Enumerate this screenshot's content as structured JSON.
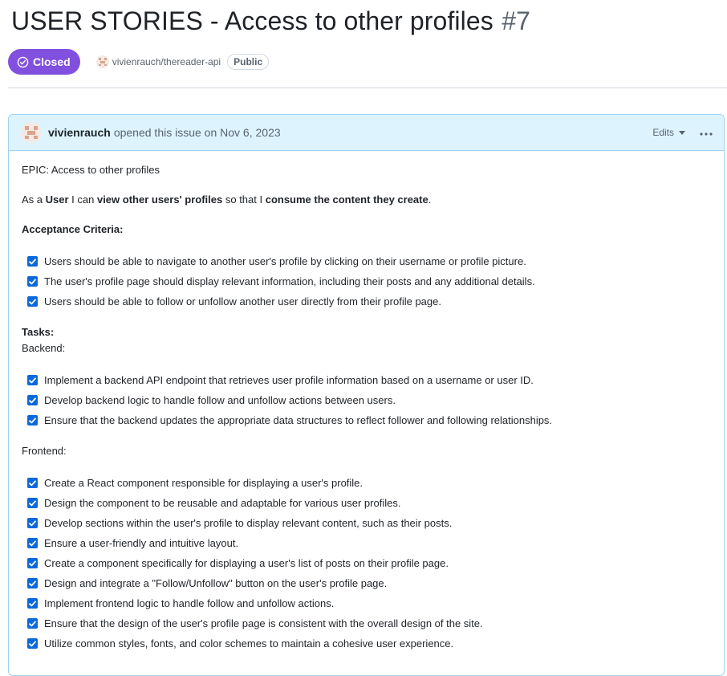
{
  "issue": {
    "title": "USER STORIES - Access to other profiles",
    "number": "#7",
    "state": "Closed",
    "repo": "vivienrauch/thereader-api",
    "visibility": "Public"
  },
  "comment": {
    "author": "vivienrauch",
    "opened_text": "opened this issue on Nov 6, 2023",
    "edits_label": "Edits",
    "epic": "EPIC: Access to other profiles",
    "story": {
      "p1": "As a ",
      "role": "User",
      "p2": " I can ",
      "action": "view other users' profiles",
      "p3": " so that I ",
      "benefit": "consume the content they create",
      "p4": "."
    },
    "acceptance_heading": "Acceptance Criteria:",
    "acceptance_items": [
      "Users should be able to navigate to another user's profile by clicking on their username or profile picture.",
      "The user's profile page should display relevant information, including their posts and any additional details.",
      "Users should be able to follow or unfollow another user directly from their profile page."
    ],
    "tasks_heading": "Tasks:",
    "backend_label": "Backend:",
    "backend_items": [
      "Implement a backend API endpoint that retrieves user profile information based on a username or user ID.",
      "Develop backend logic to handle follow and unfollow actions between users.",
      "Ensure that the backend updates the appropriate data structures to reflect follower and following relationships."
    ],
    "frontend_label": "Frontend:",
    "frontend_items": [
      "Create a React component responsible for displaying a user's profile.",
      "Design the component to be reusable and adaptable for various user profiles.",
      "Develop sections within the user's profile to display relevant content, such as their posts.",
      "Ensure a user-friendly and intuitive layout.",
      "Create a component specifically for displaying a user's list of posts on their profile page.",
      "Design and integrate a \"Follow/Unfollow\" button on the user's profile page.",
      "Implement frontend logic to handle follow and unfollow actions.",
      "Ensure that the design of the user's profile page is consistent with the overall design of the site.",
      "Utilize common styles, fonts, and color schemes to maintain a cohesive user experience."
    ]
  },
  "icons": {
    "state": "circle-check-icon",
    "edits": "caret-down-icon",
    "menu": "kebab-horizontal-icon",
    "checkbox": "checkbox-checked-icon"
  },
  "colors": {
    "closed_badge": "#8250df",
    "header_bg": "#ddf4ff",
    "header_border": "#9cd3f3",
    "checkbox": "#0969da",
    "muted_text": "#59636e"
  }
}
